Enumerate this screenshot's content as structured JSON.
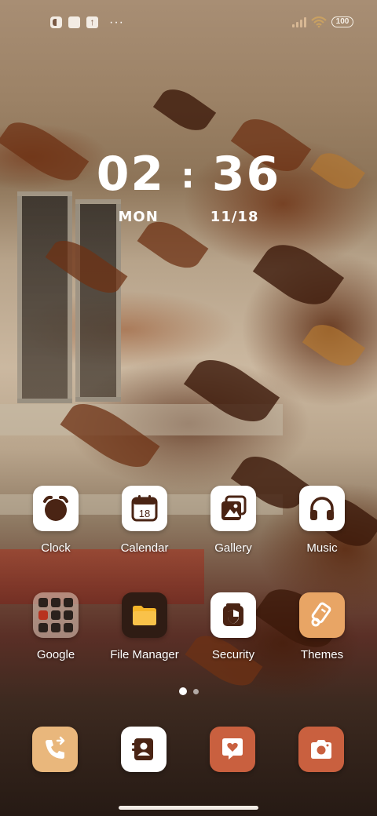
{
  "status_bar": {
    "more_indicator": "···",
    "battery": "100",
    "colors": {
      "signal": "#d8b894",
      "wifi": "#c8a062"
    }
  },
  "clock": {
    "hours": "02",
    "separator": ":",
    "minutes": "36",
    "day": "MON",
    "date": "11/18"
  },
  "apps_row1": [
    {
      "label": "Clock",
      "icon": "alarm-clock-icon"
    },
    {
      "label": "Calendar",
      "icon": "calendar-icon",
      "icon_text": "18"
    },
    {
      "label": "Gallery",
      "icon": "gallery-icon"
    },
    {
      "label": "Music",
      "icon": "headphones-icon"
    }
  ],
  "apps_row2": [
    {
      "label": "Google",
      "icon": "folder-icon"
    },
    {
      "label": "File Manager",
      "icon": "folder-file-icon"
    },
    {
      "label": "Security",
      "icon": "shield-icon"
    },
    {
      "label": "Themes",
      "icon": "paintbrush-icon"
    }
  ],
  "dock": [
    {
      "icon": "phone-icon",
      "color": "#e9b77c"
    },
    {
      "icon": "contacts-icon",
      "color": "#ffffff"
    },
    {
      "icon": "message-heart-icon",
      "color": "#c9603f"
    },
    {
      "icon": "camera-icon",
      "color": "#c9603f"
    }
  ],
  "page_indicator": {
    "pages": 2,
    "active": 0
  },
  "colors": {
    "accent_brown": "#4a2414",
    "themes_orange": "#e8a565",
    "file_manager_bg": "#2f1c14",
    "file_yellow": "#f6b52a"
  }
}
